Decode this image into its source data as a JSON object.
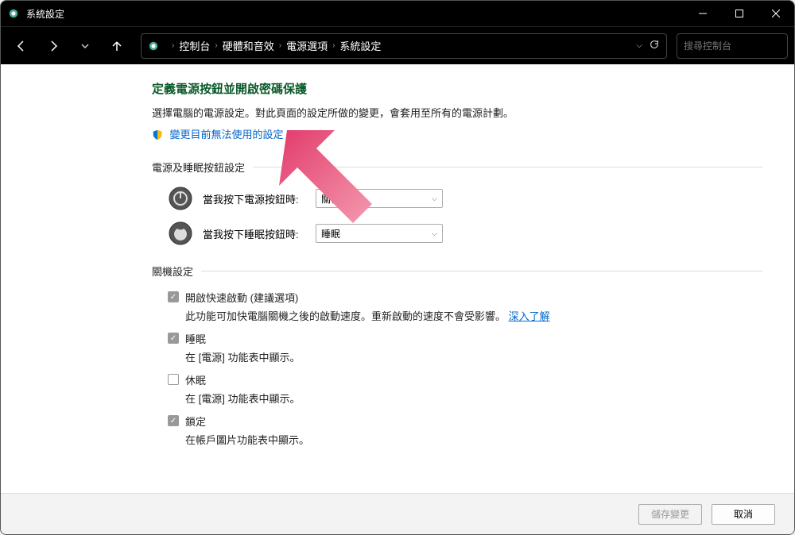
{
  "window": {
    "title": "系統設定"
  },
  "breadcrumb": {
    "items": [
      "控制台",
      "硬體和音效",
      "電源選項",
      "系統設定"
    ]
  },
  "search": {
    "placeholder": "搜尋控制台"
  },
  "page": {
    "title": "定義電源按鈕並開啟密碼保護",
    "desc": "選擇電腦的電源設定。對此頁面的設定所做的變更，會套用至所有的電源計劃。",
    "change_link": "變更目前無法使用的設定"
  },
  "section1": {
    "header": "電源及睡眠按鈕設定",
    "row1": {
      "label": "當我按下電源按鈕時:",
      "value": "關機"
    },
    "row2": {
      "label": "當我按下睡眠按鈕時:",
      "value": "睡眠"
    }
  },
  "section2": {
    "header": "關機設定",
    "fast": {
      "label": "開啟快速啟動 (建議選項)",
      "desc_a": "此功能可加快電腦關機之後的啟動速度。重新啟動的速度不會受影響。",
      "link": "深入了解"
    },
    "sleep": {
      "label": "睡眠",
      "desc": "在 [電源] 功能表中顯示。"
    },
    "hibernate": {
      "label": "休眠",
      "desc": "在 [電源] 功能表中顯示。"
    },
    "lock": {
      "label": "鎖定",
      "desc": "在帳戶圖片功能表中顯示。"
    }
  },
  "footer": {
    "save": "儲存變更",
    "cancel": "取消"
  }
}
